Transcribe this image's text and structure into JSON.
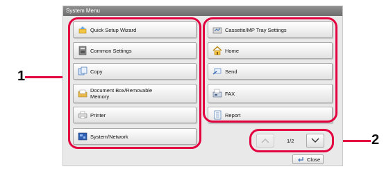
{
  "window": {
    "title": "System Menu"
  },
  "left_buttons": [
    {
      "label": "Quick Setup Wizard",
      "icon": "wizard-icon"
    },
    {
      "label": "Common Settings",
      "icon": "settings-icon"
    },
    {
      "label": "Copy",
      "icon": "copy-icon"
    },
    {
      "label": "Document Box/Removable Memory",
      "label_lines": [
        "Document Box/Removable",
        "Memory"
      ],
      "icon": "document-box-icon"
    },
    {
      "label": "Printer",
      "icon": "printer-icon"
    },
    {
      "label": "System/Network",
      "icon": "system-network-icon"
    }
  ],
  "right_buttons": [
    {
      "label": "Cassette/MP Tray Settings",
      "icon": "cassette-icon"
    },
    {
      "label": "Home",
      "icon": "home-icon"
    },
    {
      "label": "Send",
      "icon": "send-icon"
    },
    {
      "label": "FAX",
      "icon": "fax-icon"
    },
    {
      "label": "Report",
      "icon": "report-icon"
    }
  ],
  "pagination": {
    "page": "1/2"
  },
  "close_label": "Close",
  "callouts": {
    "one": "1",
    "two": "2"
  },
  "colors": {
    "highlight": "#e3003f",
    "titlebar": "#7a7a7a",
    "panel": "#e9e9e9"
  }
}
